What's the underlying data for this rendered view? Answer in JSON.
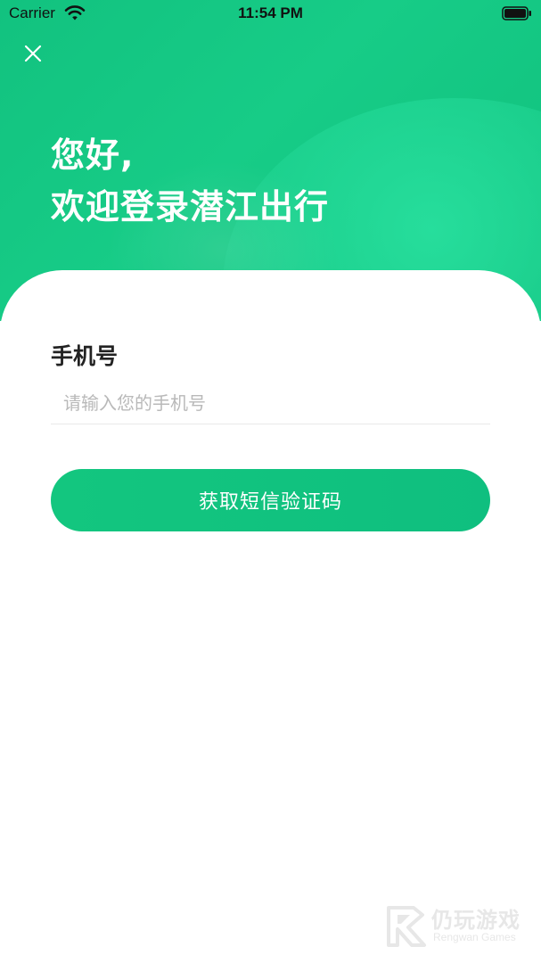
{
  "status_bar": {
    "carrier": "Carrier",
    "time": "11:54 PM"
  },
  "header": {
    "greeting_line1": "您好,",
    "greeting_line2": "欢迎登录潜江出行"
  },
  "form": {
    "phone_label": "手机号",
    "phone_placeholder": "请输入您的手机号",
    "phone_value": "",
    "submit_label": "获取短信验证码"
  },
  "watermark": {
    "title": "仍玩游戏",
    "subtitle": "Rengwan Games"
  },
  "colors": {
    "brand_green": "#13c67f",
    "header_green": "#17cc87",
    "text_dark": "#222222",
    "placeholder_gray": "#b9b9b9"
  },
  "icons": {
    "close": "close-icon",
    "wifi": "wifi-icon",
    "battery": "battery-icon",
    "watermark_logo": "rengwan-logo-icon"
  }
}
